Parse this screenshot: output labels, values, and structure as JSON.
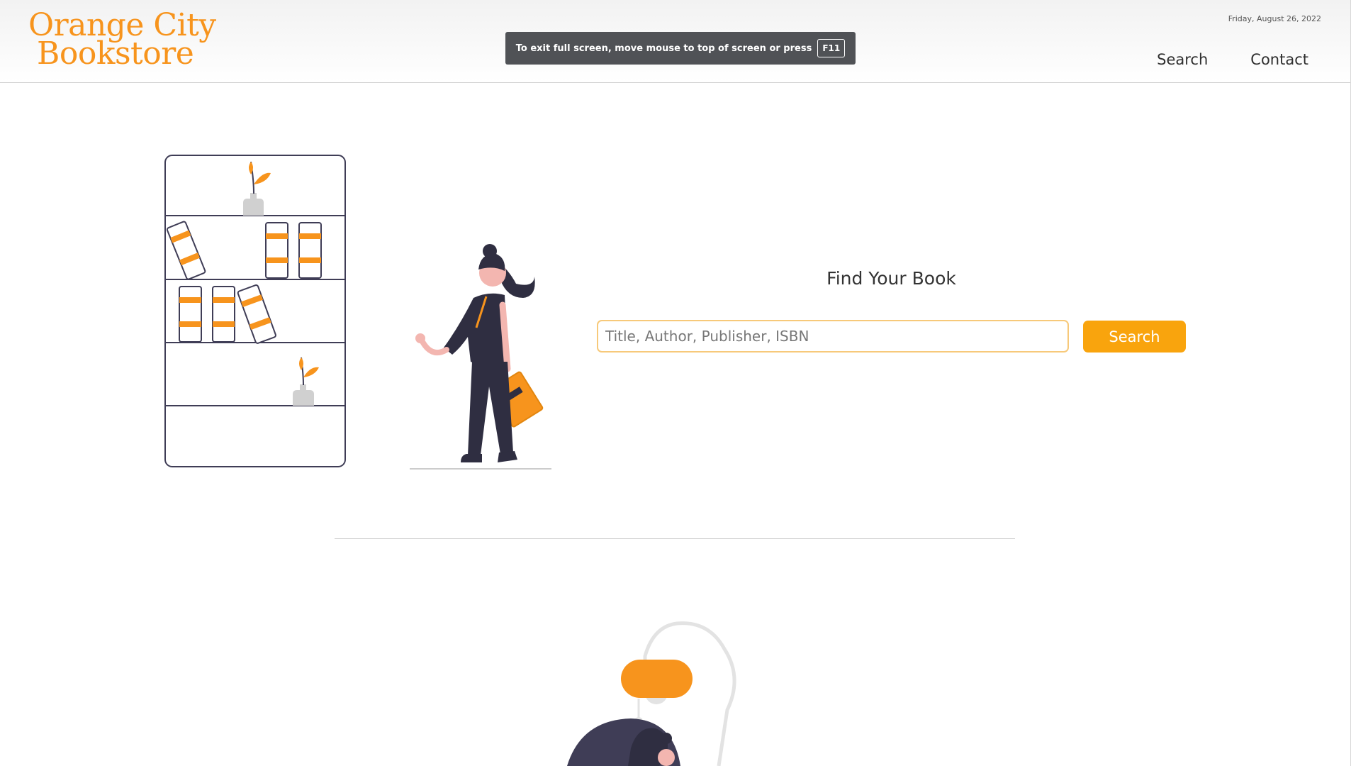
{
  "logo": {
    "line1": "Orange City",
    "line2": "Bookstore"
  },
  "fullscreen_banner": {
    "message": "To exit full screen, move mouse to top of screen or press",
    "key": "F11"
  },
  "header": {
    "date": "Friday, August 26, 2022"
  },
  "nav": {
    "items": [
      {
        "label": "Search"
      },
      {
        "label": "Contact"
      }
    ]
  },
  "finder": {
    "title": "Find Your Book",
    "placeholder": "Title, Author, Publisher, ISBN",
    "value": "",
    "button_label": "Search"
  },
  "colors": {
    "brand_orange": "#f7941d",
    "button_orange": "#f9a40d",
    "dark_figure": "#2f2e41",
    "banner_bg": "#505256"
  },
  "illustrations": [
    {
      "icon": "bookshelf-illustration"
    },
    {
      "icon": "woman-holding-book-illustration"
    },
    {
      "icon": "woman-with-lamp-illustration"
    }
  ]
}
